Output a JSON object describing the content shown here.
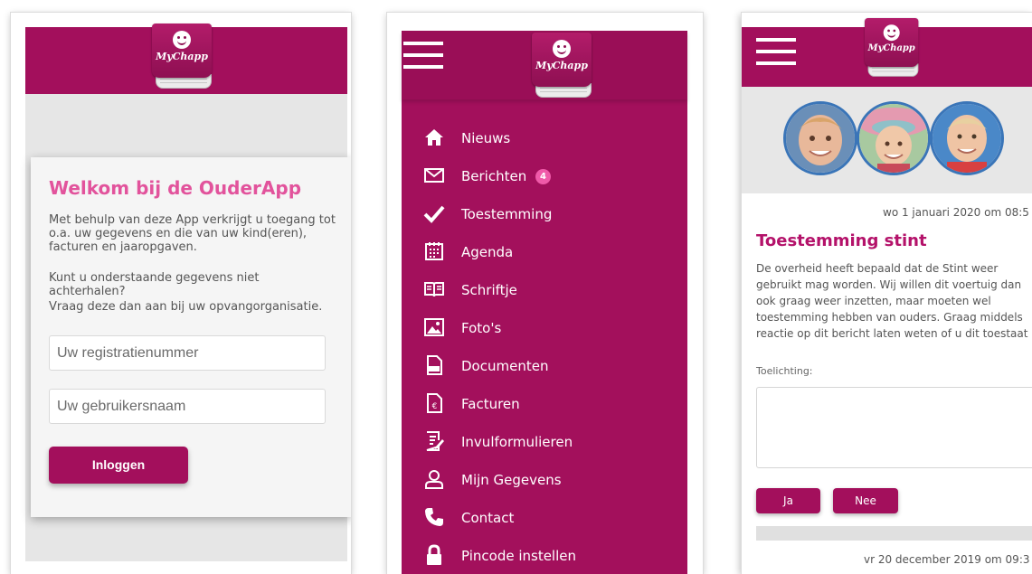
{
  "brand": {
    "logo_text": "MyChapp",
    "accent_color": "#a30f5c",
    "title_color": "#e2539c"
  },
  "login": {
    "title": "Welkom bij de OuderApp",
    "intro": "Met behulp van deze App verkrijgt u toegang tot o.a. uw gegevens en die van uw kind(eren), facturen en jaaropgaven.",
    "help_line1": "Kunt u onderstaande gegevens niet achterhalen?",
    "help_line2": "Vraag deze dan aan bij uw opvangorganisatie.",
    "registration_placeholder": "Uw registratienummer",
    "username_placeholder": "Uw gebruikersnaam",
    "login_button": "Inloggen"
  },
  "menu": {
    "items": [
      {
        "label": "Nieuws",
        "icon": "home-icon"
      },
      {
        "label": "Berichten",
        "icon": "envelope-icon",
        "badge": "4"
      },
      {
        "label": "Toestemming",
        "icon": "check-icon"
      },
      {
        "label": "Agenda",
        "icon": "calendar-icon"
      },
      {
        "label": "Schriftje",
        "icon": "book-icon"
      },
      {
        "label": "Foto's",
        "icon": "photo-icon"
      },
      {
        "label": "Documenten",
        "icon": "pdf-file-icon"
      },
      {
        "label": "Facturen",
        "icon": "euro-file-icon"
      },
      {
        "label": "Invulformulieren",
        "icon": "form-icon"
      },
      {
        "label": "Mijn Gegevens",
        "icon": "user-icon"
      },
      {
        "label": "Contact",
        "icon": "phone-icon"
      },
      {
        "label": "Pincode instellen",
        "icon": "lock-icon"
      }
    ]
  },
  "consent": {
    "date": "wo 1 januari 2020 om 08:5",
    "title": "Toestemming stint",
    "body": "De overheid heeft bepaald dat de Stint weer gebruikt mag worden. Wij willen dit voertuig dan ook graag weer inzetten, maar moeten wel toestemming hebben van ouders. Graag middels reactie op dit bericht laten weten of u dit toestaat",
    "comment_label": "Toelichting:",
    "yes_button": "Ja",
    "no_button": "Nee",
    "next_date": "vr 20 december 2019 om 09:3"
  }
}
